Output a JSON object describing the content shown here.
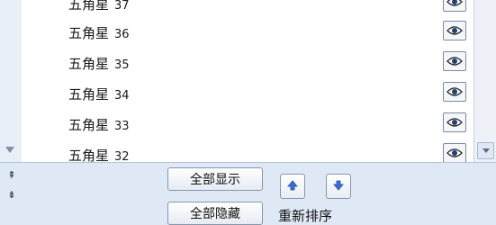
{
  "list": {
    "items": [
      {
        "name": "五角星",
        "number": "37"
      },
      {
        "name": "五角星",
        "number": "36"
      },
      {
        "name": "五角星",
        "number": "35"
      },
      {
        "name": "五角星",
        "number": "34"
      },
      {
        "name": "五角星",
        "number": "33"
      },
      {
        "name": "五角星",
        "number": "32"
      }
    ]
  },
  "buttons": {
    "show_all": "全部显示",
    "hide_all": "全部隐藏",
    "reorder_label": "重新排序"
  },
  "side_nav": {
    "up": "⇞",
    "down": "⇟"
  },
  "colors": {
    "panel_background": "#dfe8f5",
    "list_background": "#ffffff",
    "arrow_blue": "#3b6fd1"
  },
  "icons": {
    "visibility": "eye-icon",
    "move_up": "arrow-up-icon",
    "move_down": "arrow-down-icon"
  }
}
